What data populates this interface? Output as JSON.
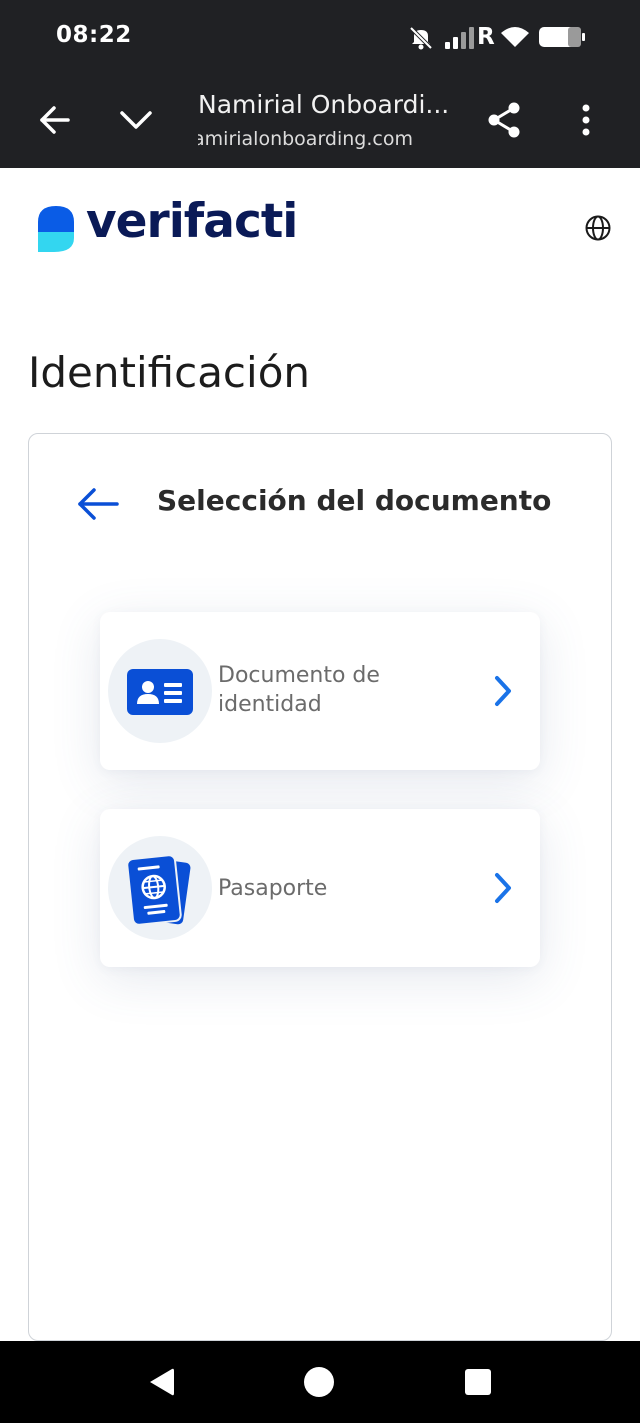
{
  "status_bar": {
    "time": "08:22",
    "network_label": "R",
    "icons": [
      "mute-icon",
      "signal-icon",
      "wifi-icon",
      "battery-icon"
    ]
  },
  "browser": {
    "title": "Namirial Onboardi...",
    "url": "namirialonboarding.com",
    "icons": [
      "back-arrow-icon",
      "chevron-down-icon",
      "share-icon",
      "more-vert-icon"
    ]
  },
  "brand": {
    "name": "verifacti",
    "accent_top": "#0a5ce6",
    "accent_bottom": "#33d6f0",
    "text_color": "#0a1a57"
  },
  "language_icon": "globe-icon",
  "page": {
    "title": "Identificación"
  },
  "document_selection": {
    "title": "Selección del documento",
    "accent_color": "#0a4fd6",
    "options": [
      {
        "label_line1": "Documento de",
        "label_line2": "identidad",
        "icon": "id-card-icon"
      },
      {
        "label": "Pasaporte",
        "icon": "passport-icon"
      }
    ]
  },
  "nav_bar": {
    "icons": [
      "nav-back-icon",
      "nav-home-icon",
      "nav-recents-icon"
    ]
  }
}
